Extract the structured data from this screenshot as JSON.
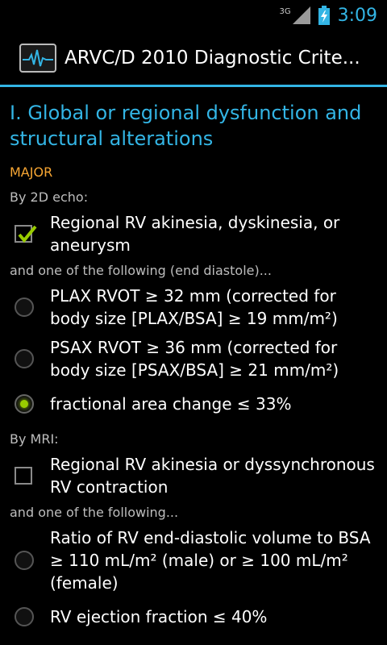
{
  "status_bar": {
    "network": "3G",
    "time": "3:09"
  },
  "action_bar": {
    "title": "ARVC/D 2010 Diagnostic Crite..."
  },
  "section": {
    "title": "I. Global or regional dysfunction and structural alterations",
    "major_label": "MAJOR",
    "echo": {
      "heading": "By 2D echo:",
      "criterion": {
        "label": "Regional RV akinesia, dyskinesia, or aneurysm",
        "checked": true
      },
      "followup_note": "and one of the following (end diastole)...",
      "options": [
        {
          "label": "PLAX RVOT ≥ 32 mm (corrected for body size [PLAX/BSA] ≥ 19 mm/m²)",
          "selected": false
        },
        {
          "label": "PSAX RVOT ≥ 36 mm (corrected for body size [PSAX/BSA] ≥ 21 mm/m²)",
          "selected": false
        },
        {
          "label": "fractional area change ≤ 33%",
          "selected": true
        }
      ]
    },
    "mri": {
      "heading": "By MRI:",
      "criterion": {
        "label": "Regional RV akinesia or dyssynchronous RV contraction",
        "checked": false
      },
      "followup_note": "and one of the following...",
      "options": [
        {
          "label": "Ratio of RV end-diastolic volume to BSA ≥ 110 mL/m² (male) or ≥ 100 mL/m² (female)",
          "selected": false
        },
        {
          "label": "RV ejection fraction ≤ 40%",
          "selected": false
        }
      ]
    }
  },
  "colors": {
    "accent": "#33b5e5",
    "major": "#f7a633",
    "radio_on": "#99cc00"
  }
}
